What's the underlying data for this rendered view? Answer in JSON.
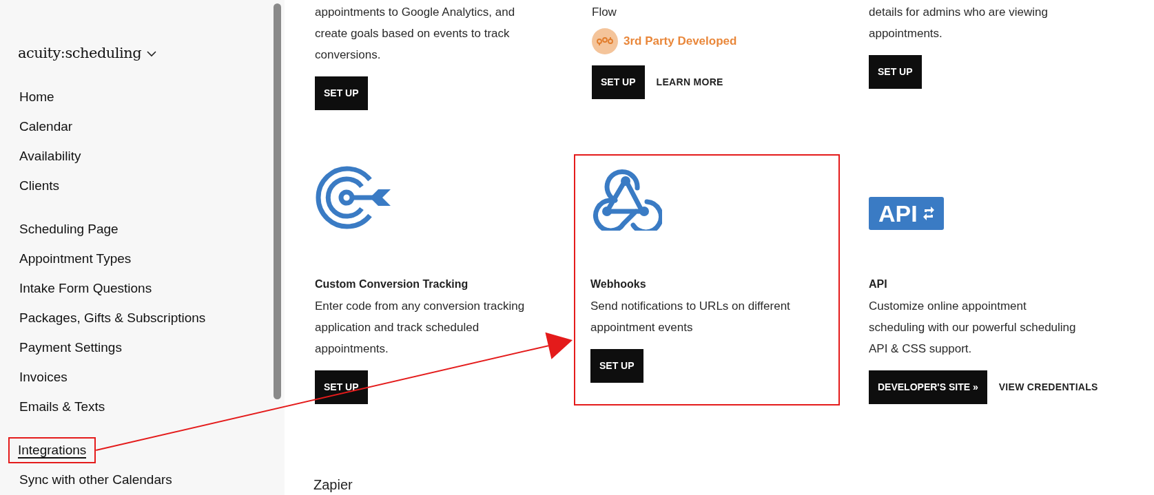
{
  "sidebar": {
    "logo": {
      "text": "acuity:scheduling",
      "dropdown": true
    },
    "nav_groups": [
      [
        {
          "label": "Home",
          "selected": false,
          "highlighted": false
        },
        {
          "label": "Calendar",
          "selected": false,
          "highlighted": false
        },
        {
          "label": "Availability",
          "selected": false,
          "highlighted": false
        },
        {
          "label": "Clients",
          "selected": false,
          "highlighted": false
        }
      ],
      [
        {
          "label": "Scheduling Page",
          "selected": false,
          "highlighted": false
        },
        {
          "label": "Appointment Types",
          "selected": false,
          "highlighted": false
        },
        {
          "label": "Intake Form Questions",
          "selected": false,
          "highlighted": false
        },
        {
          "label": "Packages, Gifts & Subscriptions",
          "selected": false,
          "highlighted": false
        },
        {
          "label": "Payment Settings",
          "selected": false,
          "highlighted": false
        },
        {
          "label": "Invoices",
          "selected": false,
          "highlighted": false
        },
        {
          "label": "Emails & Texts",
          "selected": false,
          "highlighted": false
        }
      ],
      [
        {
          "label": "Integrations",
          "selected": true,
          "highlighted": true
        },
        {
          "label": "Sync with other Calendars",
          "selected": false,
          "highlighted": false
        }
      ]
    ]
  },
  "card_rows": [
    [
      {
        "description_lines": [
          "appointments to Google Analytics, and",
          "create goals based on events to track",
          "conversions."
        ],
        "highlighted": false,
        "buttons": [
          {
            "label": "SET UP",
            "kind": "primary"
          }
        ]
      },
      {
        "description_lines": [
          "Flow"
        ],
        "badge": "3rd Party Developed",
        "highlighted": false,
        "buttons": [
          {
            "label": "SET UP",
            "kind": "primary"
          },
          {
            "label": "LEARN MORE",
            "kind": "link"
          }
        ]
      },
      {
        "description_lines": [
          "details for admins who are viewing",
          "appointments."
        ],
        "highlighted": false,
        "buttons": [
          {
            "label": "SET UP",
            "kind": "primary"
          }
        ]
      }
    ],
    [
      {
        "icon": {
          "kind": "target"
        },
        "title": "Custom Conversion Tracking",
        "description_lines": [
          "Enter code from any conversion tracking",
          "application and track scheduled",
          "appointments."
        ],
        "highlighted": false,
        "buttons": [
          {
            "label": "SET UP",
            "kind": "primary"
          }
        ]
      },
      {
        "icon": {
          "kind": "webhook"
        },
        "title": "Webhooks",
        "description_lines": [
          "Send notifications to URLs on different",
          "appointment events"
        ],
        "highlighted": true,
        "buttons": [
          {
            "label": "SET UP",
            "kind": "primary"
          }
        ]
      },
      {
        "icon": {
          "kind": "api",
          "text": "API"
        },
        "title": "API",
        "description_lines": [
          "Customize online appointment",
          "scheduling with our powerful scheduling",
          "API & CSS support."
        ],
        "highlighted": false,
        "buttons": [
          {
            "label": "DEVELOPER'S SITE »",
            "kind": "primary"
          },
          {
            "label": "VIEW CREDENTIALS",
            "kind": "link"
          }
        ]
      }
    ]
  ],
  "section_heading": "Zapier",
  "callout_arrow": true
}
